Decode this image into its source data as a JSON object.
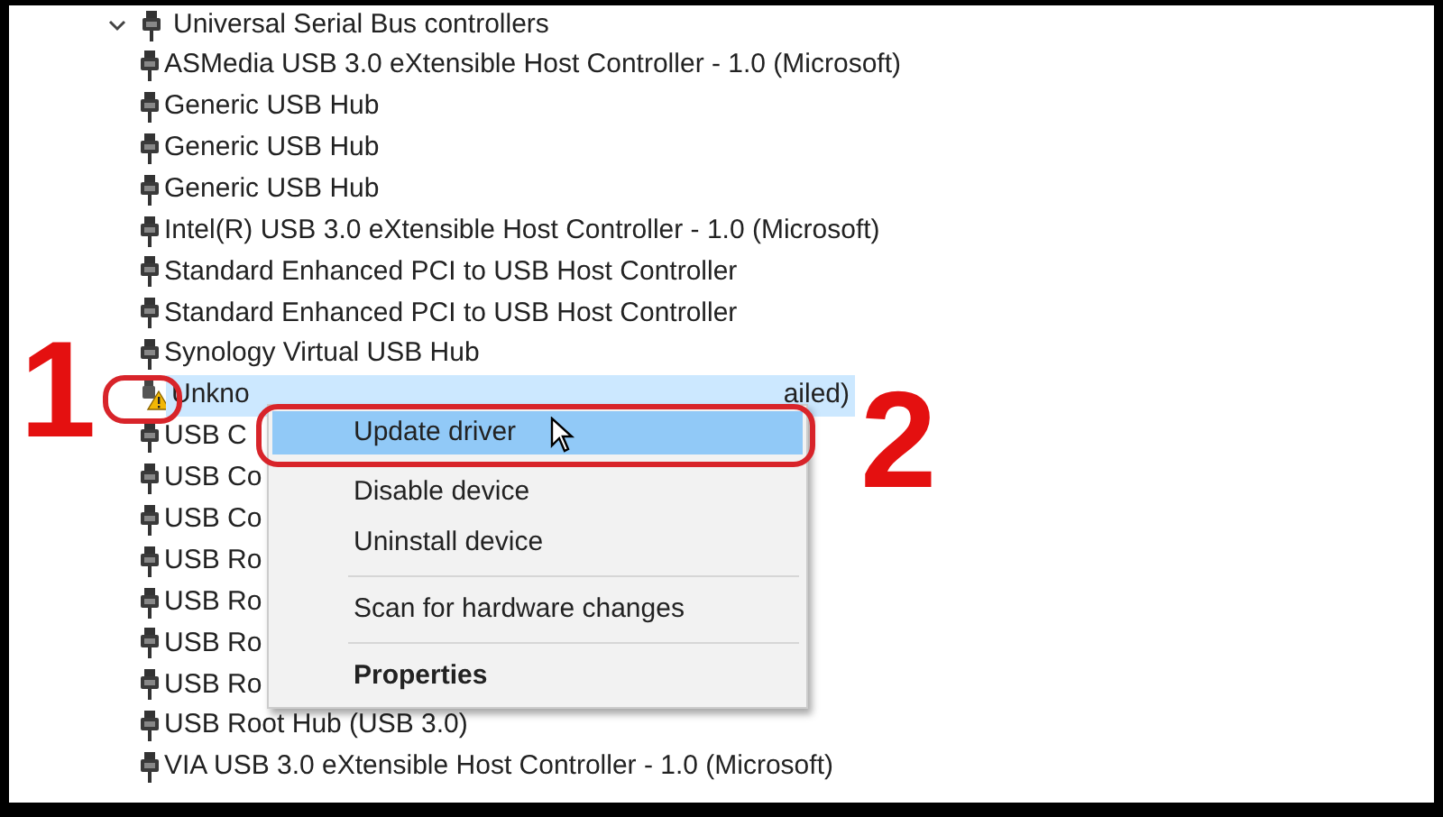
{
  "tree": {
    "label": "Universal Serial Bus controllers",
    "expanded": true,
    "children": [
      {
        "label": "ASMedia USB 3.0 eXtensible Host Controller - 1.0 (Microsoft)",
        "kind": "usb",
        "selected": false
      },
      {
        "label": "Generic USB Hub",
        "kind": "usb",
        "selected": false
      },
      {
        "label": "Generic USB Hub",
        "kind": "usb",
        "selected": false
      },
      {
        "label": "Generic USB Hub",
        "kind": "usb",
        "selected": false
      },
      {
        "label": "Intel(R) USB 3.0 eXtensible Host Controller - 1.0 (Microsoft)",
        "kind": "usb",
        "selected": false
      },
      {
        "label": "Standard Enhanced PCI to USB Host Controller",
        "kind": "usb",
        "selected": false
      },
      {
        "label": "Standard Enhanced PCI to USB Host Controller",
        "kind": "usb",
        "selected": false
      },
      {
        "label": "Synology Virtual USB Hub",
        "kind": "usb",
        "selected": false
      },
      {
        "label": "Unkno",
        "tail": "ailed)",
        "kind": "warning",
        "selected": true
      },
      {
        "label": "USB C",
        "kind": "usb",
        "selected": false
      },
      {
        "label": "USB Co",
        "kind": "usb",
        "selected": false
      },
      {
        "label": "USB Co",
        "kind": "usb",
        "selected": false
      },
      {
        "label": "USB Ro",
        "kind": "usb",
        "selected": false
      },
      {
        "label": "USB Ro",
        "kind": "usb",
        "selected": false
      },
      {
        "label": "USB Ro",
        "kind": "usb",
        "selected": false
      },
      {
        "label": "USB Ro",
        "kind": "usb",
        "selected": false
      },
      {
        "label": "USB Root Hub (USB 3.0)",
        "kind": "usb",
        "selected": false
      },
      {
        "label": "VIA USB 3.0 eXtensible Host Controller - 1.0 (Microsoft)",
        "kind": "usb",
        "selected": false
      }
    ]
  },
  "context_menu": [
    {
      "kind": "item",
      "label": "Update driver",
      "selected": true
    },
    {
      "kind": "item",
      "label": "Disable device",
      "selected": false
    },
    {
      "kind": "item",
      "label": "Uninstall device",
      "selected": false
    },
    {
      "kind": "separator"
    },
    {
      "kind": "item",
      "label": "Scan for hardware changes",
      "selected": false
    },
    {
      "kind": "separator"
    },
    {
      "kind": "default",
      "label": "Properties",
      "selected": false
    }
  ],
  "annotations": [
    {
      "number": "1"
    },
    {
      "number": "2"
    }
  ]
}
